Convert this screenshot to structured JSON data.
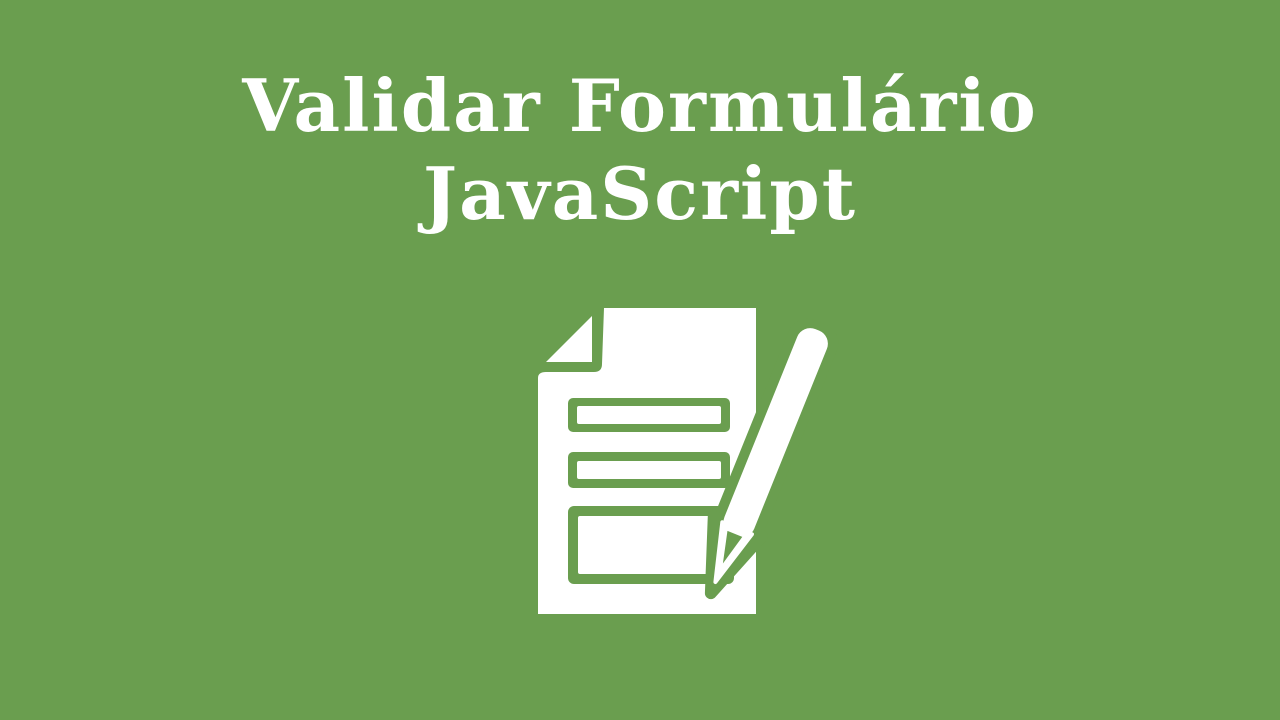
{
  "title": {
    "line1": "Validar Formulário",
    "line2": "JavaScript"
  },
  "icon": {
    "name": "form-with-pencil-icon",
    "foreground": "#ffffff",
    "background": "#6a9e4f"
  }
}
